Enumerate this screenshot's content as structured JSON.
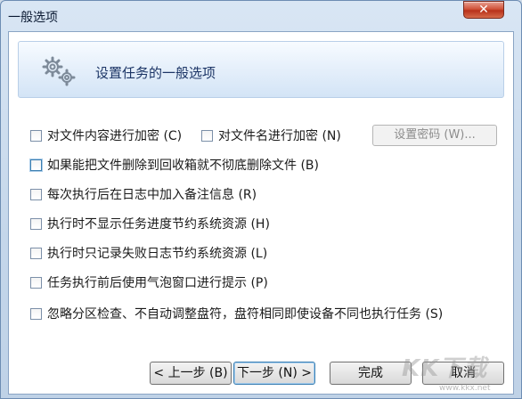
{
  "window": {
    "title": "一般选项",
    "close_label": "✕"
  },
  "header": {
    "title": "设置任务的一般选项",
    "icon": "gears-icon"
  },
  "options": [
    {
      "label": "对文件内容进行加密 (C)",
      "checked": false
    },
    {
      "label": "对文件名进行加密 (N)",
      "checked": false
    },
    {
      "label": "如果能把文件删除到回收箱就不彻底删除文件 (B)",
      "checked": false
    },
    {
      "label": "每次执行后在日志中加入备注信息 (R)",
      "checked": false
    },
    {
      "label": "执行时不显示任务进度节约系统资源 (H)",
      "checked": false
    },
    {
      "label": "执行时只记录失败日志节约系统资源 (L)",
      "checked": false
    },
    {
      "label": "任务执行前后使用气泡窗口进行提示 (P)",
      "checked": false
    },
    {
      "label": "忽略分区检查、不自动调整盘符，盘符相同即使设备不同也执行任务 (S)",
      "checked": false
    }
  ],
  "password_button": "设置密码 (W)...",
  "buttons": {
    "back": "< 上一步 (B)",
    "next": "下一步 (N) >",
    "finish": "完成",
    "cancel": "取消"
  },
  "watermark": {
    "text": "KK下载",
    "url": "www.kkx.net"
  }
}
